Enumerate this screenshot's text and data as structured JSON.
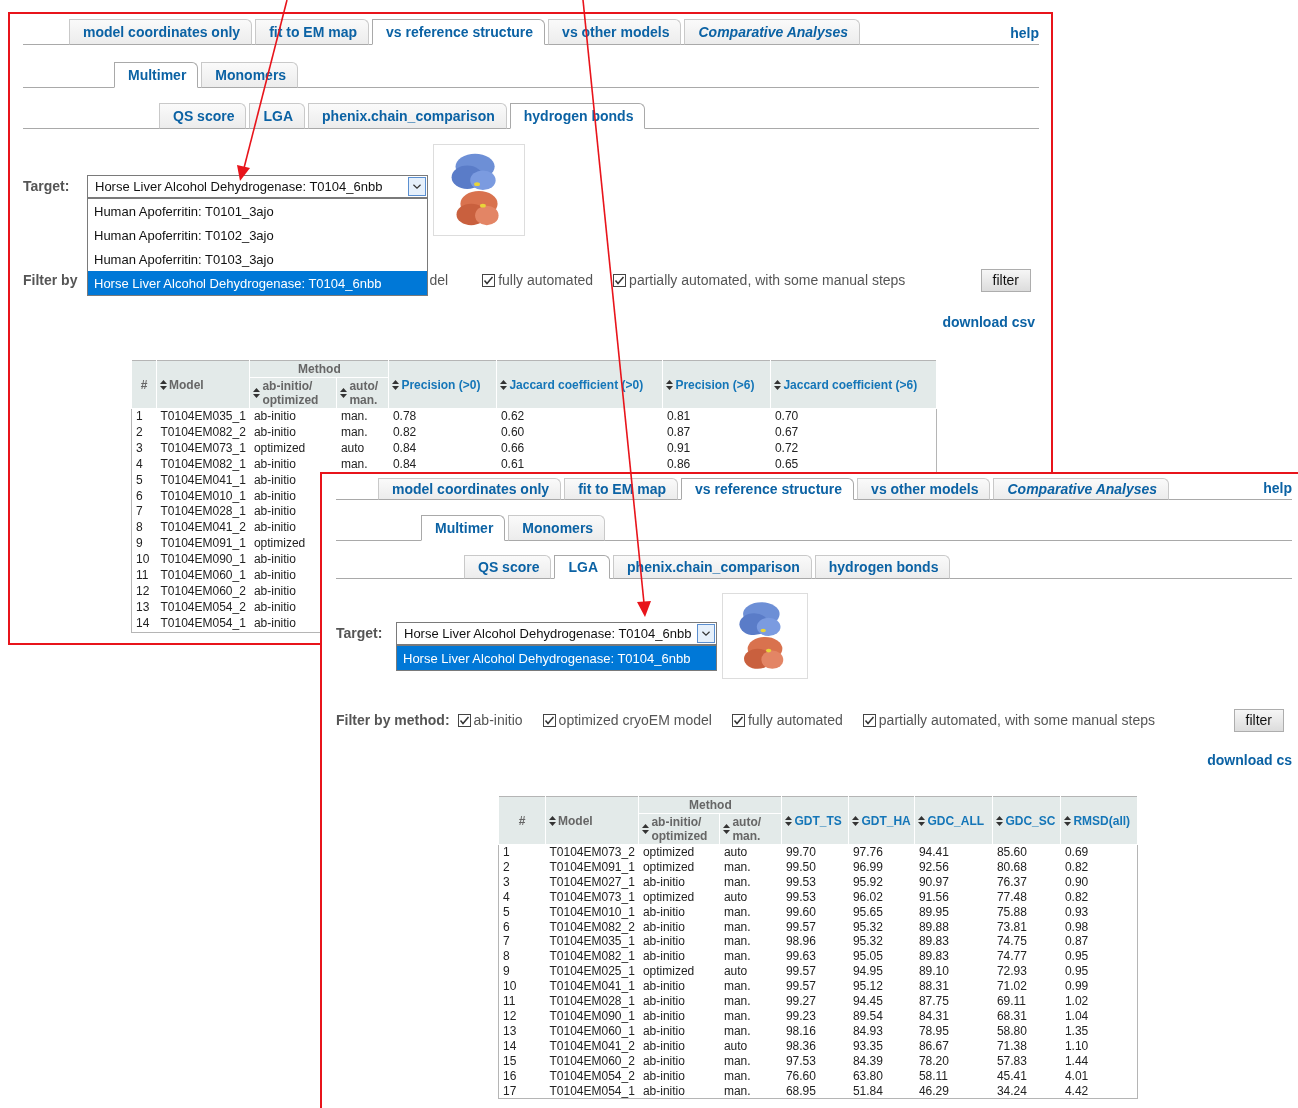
{
  "screens": [
    {
      "main_tabs": [
        {
          "label": "model coordinates only",
          "selected": false,
          "italic": false
        },
        {
          "label": "fit to EM map",
          "selected": false,
          "italic": false
        },
        {
          "label": "vs reference structure",
          "selected": true,
          "italic": false
        },
        {
          "label": "vs other models",
          "selected": false,
          "italic": false
        },
        {
          "label": "Comparative Analyses",
          "selected": false,
          "italic": true
        }
      ],
      "help": "help",
      "sub_tabs": [
        {
          "label": "Multimer",
          "selected": true
        },
        {
          "label": "Monomers",
          "selected": false
        }
      ],
      "metric_tabs": [
        {
          "label": "QS score",
          "selected": false
        },
        {
          "label": "LGA",
          "selected": false
        },
        {
          "label": "phenix.chain_comparison",
          "selected": false
        },
        {
          "label": "hydrogen bonds",
          "selected": true
        }
      ],
      "target": {
        "label": "Target:",
        "value": "Horse Liver Alcohol Dehydrogenase: T0104_6nbb",
        "options": [
          {
            "label": "Human Apoferritin: T0101_3ajo",
            "selected": false
          },
          {
            "label": "Human Apoferritin: T0102_3ajo",
            "selected": false
          },
          {
            "label": "Human Apoferritin: T0103_3ajo",
            "selected": false
          },
          {
            "label": "Horse Liver Alcohol Dehydrogenase: T0104_6nbb",
            "selected": true
          }
        ]
      },
      "filter": {
        "label": "Filter by",
        "items": [
          {
            "kind": "text",
            "label": "del"
          },
          {
            "kind": "checkbox",
            "label": "fully automated",
            "checked": true
          },
          {
            "kind": "checkbox",
            "label": "partially automated, with some manual steps",
            "checked": true
          }
        ],
        "button": "filter"
      },
      "download": "download csv",
      "table": {
        "columns": [
          {
            "label": "#",
            "kind": "plain"
          },
          {
            "label": "Model",
            "kind": "sort"
          },
          {
            "label": "Method",
            "kind": "group",
            "colspan": 2,
            "children": [
              {
                "label": "ab-initio/ optimized",
                "kind": "sort"
              },
              {
                "label": "auto/ man.",
                "kind": "sort"
              }
            ]
          },
          {
            "label": "Precision (>0)",
            "kind": "metric"
          },
          {
            "label": "Jaccard coefficient (>0)",
            "kind": "metric"
          },
          {
            "label": "Precision (>6)",
            "kind": "metric"
          },
          {
            "label": "Jaccard coefficient (>6)",
            "kind": "metric"
          }
        ],
        "rows": [
          [
            "1",
            "T0104EM035_1",
            "ab-initio",
            "man.",
            "0.78",
            "0.62",
            "0.81",
            "0.70"
          ],
          [
            "2",
            "T0104EM082_2",
            "ab-initio",
            "man.",
            "0.82",
            "0.60",
            "0.87",
            "0.67"
          ],
          [
            "3",
            "T0104EM073_1",
            "optimized",
            "auto",
            "0.84",
            "0.66",
            "0.91",
            "0.72"
          ],
          [
            "4",
            "T0104EM082_1",
            "ab-initio",
            "man.",
            "0.84",
            "0.61",
            "0.86",
            "0.65"
          ],
          [
            "5",
            "T0104EM041_1",
            "ab-initio"
          ],
          [
            "6",
            "T0104EM010_1",
            "ab-initio"
          ],
          [
            "7",
            "T0104EM028_1",
            "ab-initio"
          ],
          [
            "8",
            "T0104EM041_2",
            "ab-initio"
          ],
          [
            "9",
            "T0104EM091_1",
            "optimized"
          ],
          [
            "10",
            "T0104EM090_1",
            "ab-initio"
          ],
          [
            "11",
            "T0104EM060_1",
            "ab-initio"
          ],
          [
            "12",
            "T0104EM060_2",
            "ab-initio"
          ],
          [
            "13",
            "T0104EM054_2",
            "ab-initio"
          ],
          [
            "14",
            "T0104EM054_1",
            "ab-initio"
          ]
        ]
      }
    },
    {
      "main_tabs": [
        {
          "label": "model coordinates only",
          "selected": false,
          "italic": false
        },
        {
          "label": "fit to EM map",
          "selected": false,
          "italic": false
        },
        {
          "label": "vs reference structure",
          "selected": true,
          "italic": false
        },
        {
          "label": "vs other models",
          "selected": false,
          "italic": false
        },
        {
          "label": "Comparative Analyses",
          "selected": false,
          "italic": true
        }
      ],
      "help": "help",
      "sub_tabs": [
        {
          "label": "Multimer",
          "selected": true
        },
        {
          "label": "Monomers",
          "selected": false
        }
      ],
      "metric_tabs": [
        {
          "label": "QS score",
          "selected": false
        },
        {
          "label": "LGA",
          "selected": true
        },
        {
          "label": "phenix.chain_comparison",
          "selected": false
        },
        {
          "label": "hydrogen bonds",
          "selected": false
        }
      ],
      "target": {
        "label": "Target:",
        "value": "Horse Liver Alcohol Dehydrogenase: T0104_6nbb",
        "options": [
          {
            "label": "Horse Liver Alcohol Dehydrogenase: T0104_6nbb",
            "selected": true
          }
        ]
      },
      "filter": {
        "label": "Filter by method:",
        "items": [
          {
            "kind": "checkbox",
            "label": "ab-initio",
            "checked": true
          },
          {
            "kind": "checkbox",
            "label": "optimized cryoEM model",
            "checked": true
          },
          {
            "kind": "checkbox",
            "label": "fully automated",
            "checked": true
          },
          {
            "kind": "checkbox",
            "label": "partially automated, with some manual steps",
            "checked": true
          }
        ],
        "button": "filter"
      },
      "download": "download cs",
      "table": {
        "columns": [
          {
            "label": "#",
            "kind": "plain"
          },
          {
            "label": "Model",
            "kind": "sort"
          },
          {
            "label": "Method",
            "kind": "group",
            "colspan": 2,
            "children": [
              {
                "label": "ab-initio/ optimized",
                "kind": "sort"
              },
              {
                "label": "auto/ man.",
                "kind": "sort"
              }
            ]
          },
          {
            "label": "GDT_TS",
            "kind": "metric"
          },
          {
            "label": "GDT_HA",
            "kind": "metric"
          },
          {
            "label": "GDC_ALL",
            "kind": "metric"
          },
          {
            "label": "GDC_SC",
            "kind": "metric"
          },
          {
            "label": "RMSD(all)",
            "kind": "metric"
          }
        ],
        "rows": [
          [
            "1",
            "T0104EM073_2",
            "optimized",
            "auto",
            "99.70",
            "97.76",
            "94.41",
            "85.60",
            "0.69"
          ],
          [
            "2",
            "T0104EM091_1",
            "optimized",
            "man.",
            "99.50",
            "96.99",
            "92.56",
            "80.68",
            "0.82"
          ],
          [
            "3",
            "T0104EM027_1",
            "ab-initio",
            "man.",
            "99.53",
            "95.92",
            "90.97",
            "76.37",
            "0.90"
          ],
          [
            "4",
            "T0104EM073_1",
            "optimized",
            "auto",
            "99.53",
            "96.02",
            "91.56",
            "77.48",
            "0.82"
          ],
          [
            "5",
            "T0104EM010_1",
            "ab-initio",
            "man.",
            "99.60",
            "95.65",
            "89.95",
            "75.88",
            "0.93"
          ],
          [
            "6",
            "T0104EM082_2",
            "ab-initio",
            "man.",
            "99.57",
            "95.32",
            "89.88",
            "73.81",
            "0.98"
          ],
          [
            "7",
            "T0104EM035_1",
            "ab-initio",
            "man.",
            "98.96",
            "95.32",
            "89.83",
            "74.75",
            "0.87"
          ],
          [
            "8",
            "T0104EM082_1",
            "ab-initio",
            "man.",
            "99.63",
            "95.05",
            "89.83",
            "74.77",
            "0.95"
          ],
          [
            "9",
            "T0104EM025_1",
            "optimized",
            "auto",
            "99.57",
            "94.95",
            "89.10",
            "72.93",
            "0.95"
          ],
          [
            "10",
            "T0104EM041_1",
            "ab-initio",
            "man.",
            "99.57",
            "95.12",
            "88.31",
            "71.02",
            "0.99"
          ],
          [
            "11",
            "T0104EM028_1",
            "ab-initio",
            "man.",
            "99.27",
            "94.45",
            "87.75",
            "69.11",
            "1.02"
          ],
          [
            "12",
            "T0104EM090_1",
            "ab-initio",
            "man.",
            "99.23",
            "89.54",
            "84.31",
            "68.31",
            "1.04"
          ],
          [
            "13",
            "T0104EM060_1",
            "ab-initio",
            "man.",
            "98.16",
            "84.93",
            "78.95",
            "58.80",
            "1.35"
          ],
          [
            "14",
            "T0104EM041_2",
            "ab-initio",
            "auto",
            "98.36",
            "93.35",
            "86.67",
            "71.38",
            "1.10"
          ],
          [
            "15",
            "T0104EM060_2",
            "ab-initio",
            "man.",
            "97.53",
            "84.39",
            "78.20",
            "57.83",
            "1.44"
          ],
          [
            "16",
            "T0104EM054_2",
            "ab-initio",
            "man.",
            "76.60",
            "63.80",
            "58.11",
            "45.41",
            "4.01"
          ],
          [
            "17",
            "T0104EM054_1",
            "ab-initio",
            "man.",
            "68.95",
            "51.84",
            "46.29",
            "34.24",
            "4.42"
          ]
        ]
      }
    }
  ]
}
